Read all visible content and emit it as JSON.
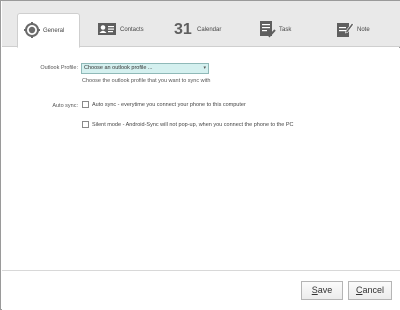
{
  "window": {
    "close_label": "×"
  },
  "tabs": [
    {
      "label": "General",
      "icon": "gear-icon",
      "active": true
    },
    {
      "label": "Contacts",
      "icon": "contact-card-icon",
      "active": false
    },
    {
      "label": "Calendar",
      "icon": "calendar-icon",
      "active": false,
      "icon_text": "31"
    },
    {
      "label": "Task",
      "icon": "task-checklist-icon",
      "active": false
    },
    {
      "label": "Note",
      "icon": "note-pencil-icon",
      "active": false
    }
  ],
  "general": {
    "outlook_profile_label": "Outlook Profile:",
    "outlook_profile_value": "Choose an outlook profile ...",
    "outlook_profile_hint": "Choose the outlook profile that you want to sync with",
    "auto_sync_label": "Auto sync:",
    "auto_sync_option": "Auto sync - everytime you connect your phone to this computer",
    "auto_sync_checked": false,
    "silent_mode_option": "Silent mode - Android-Sync will not pop-up, when you connect the phone to the PC",
    "silent_mode_checked": false
  },
  "footer": {
    "save_rest": "ave",
    "save_access": "S",
    "cancel_access": "C",
    "cancel_rest": "ancel"
  },
  "colors": {
    "accent": "#d4f0ef",
    "tab_bg": "#e9e9e9"
  }
}
